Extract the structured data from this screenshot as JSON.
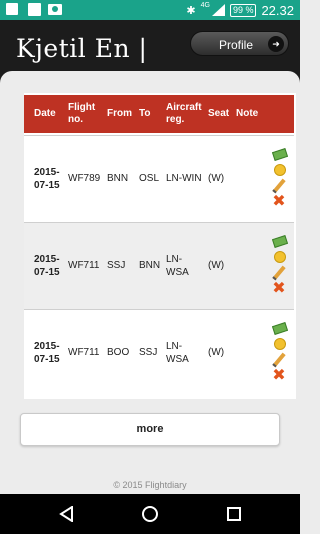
{
  "status_bar": {
    "network": "4G",
    "battery": "99 %",
    "time": "22.32"
  },
  "header": {
    "title": "Kjetil En |",
    "profile_label": "Profile"
  },
  "table": {
    "headers": {
      "date": "Date",
      "flight_line1": "Flight",
      "flight_line2": "no.",
      "from": "From",
      "to": "To",
      "aircraft_line1": "Aircraft",
      "aircraft_line2": "reg.",
      "seat": "Seat",
      "note": "Note"
    },
    "rows": [
      {
        "date_line1": "2015-",
        "date_line2": "07-15",
        "flight": "WF789",
        "from": "BNN",
        "to": "OSL",
        "reg_line1": "LN-WIN",
        "reg_line2": "",
        "seat": "(W)"
      },
      {
        "date_line1": "2015-",
        "date_line2": "07-15",
        "flight": "WF711",
        "from": "SSJ",
        "to": "BNN",
        "reg_line1": "LN-",
        "reg_line2": "WSA",
        "seat": "(W)"
      },
      {
        "date_line1": "2015-",
        "date_line2": "07-15",
        "flight": "WF711",
        "from": "BOO",
        "to": "SSJ",
        "reg_line1": "LN-",
        "reg_line2": "WSA",
        "seat": "(W)"
      }
    ]
  },
  "more_label": "more",
  "footer": "© 2015 Flightdiary",
  "colors": {
    "status_bar": "#1aa38a",
    "header": "#1c1c1c",
    "table_header": "#be3223"
  }
}
